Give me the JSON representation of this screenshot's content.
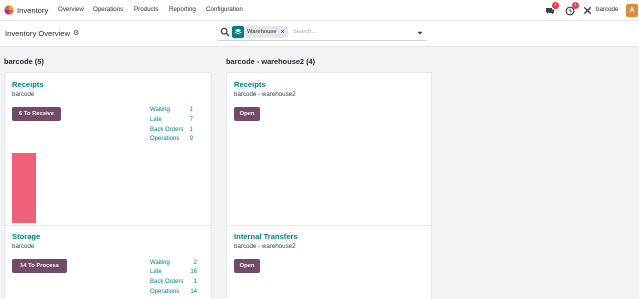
{
  "app": {
    "name": "Inventory"
  },
  "menu": [
    "Overview",
    "Operations",
    "Products",
    "Reporting",
    "Configuration"
  ],
  "topbar": {
    "messages_badge": "1",
    "activities_badge": "1",
    "user": "barcode",
    "avatar_initial": "A"
  },
  "controlbar": {
    "title": "Inventory Overview",
    "facet_label": "Warehouse",
    "search_placeholder": "Search..."
  },
  "groups": [
    {
      "title": "barcode (5)",
      "cards": [
        {
          "title": "Receipts",
          "subtitle": "barcode",
          "button": "6 To Receive",
          "stats": [
            {
              "label": "Waiting",
              "value": "1"
            },
            {
              "label": "Late",
              "value": "7"
            },
            {
              "label": "Back Orders",
              "value": "1"
            },
            {
              "label": "Operations",
              "value": "9"
            }
          ],
          "graph_bar_fraction": 0.9
        },
        {
          "title": "Storage",
          "subtitle": "barcode",
          "button": "14 To Process",
          "stats": [
            {
              "label": "Waiting",
              "value": "2"
            },
            {
              "label": "Late",
              "value": "16"
            },
            {
              "label": "Back Orders",
              "value": "1"
            },
            {
              "label": "Operations",
              "value": "14"
            }
          ]
        }
      ]
    },
    {
      "title": "barcode - warehouse2 (4)",
      "cards": [
        {
          "title": "Receipts",
          "subtitle": "barcode - warehouse2",
          "button": "Open"
        },
        {
          "title": "Internal Transfers",
          "subtitle": "barcode - warehouse2",
          "button": "Open"
        }
      ]
    }
  ],
  "colors": {
    "accent": "#017e84",
    "primary": "#714b67",
    "bar": "#ef6079",
    "badge": "#e53e3e",
    "avatar": "#e08a3a"
  }
}
